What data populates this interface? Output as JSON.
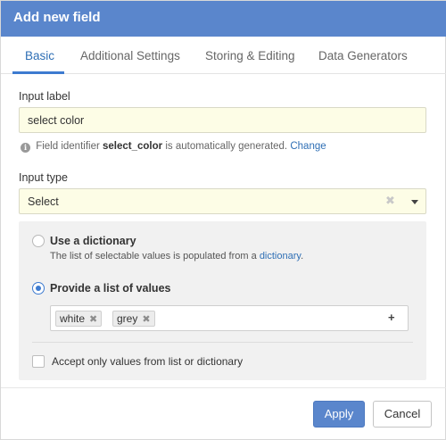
{
  "dialog": {
    "title": "Add new field"
  },
  "tabs": [
    {
      "label": "Basic",
      "active": true
    },
    {
      "label": "Additional Settings",
      "active": false
    },
    {
      "label": "Storing & Editing",
      "active": false
    },
    {
      "label": "Data Generators",
      "active": false
    }
  ],
  "input_label": {
    "label": "Input label",
    "value": "select color"
  },
  "hint": {
    "prefix": "Field identifier",
    "identifier": "select_color",
    "suffix": "is automatically generated.",
    "link": "Change",
    "icon": "info-icon"
  },
  "input_type": {
    "label": "Input type",
    "value": "Select",
    "clear_icon": "✖",
    "arrow_icon": "caret-down-icon"
  },
  "options": {
    "dictionary": {
      "title": "Use a dictionary",
      "desc_prefix": "The list of selectable values is populated from a",
      "desc_link": "dictionary",
      "desc_suffix": ".",
      "checked": false
    },
    "list": {
      "title": "Provide a list of values",
      "checked": true,
      "values": [
        {
          "label": "white",
          "remove": "✖"
        },
        {
          "label": "grey",
          "remove": "✖"
        }
      ],
      "add_icon": "+"
    },
    "restrict": {
      "label": "Accept only values from list or dictionary",
      "checked": false
    }
  },
  "footer": {
    "apply": "Apply",
    "cancel": "Cancel"
  },
  "colors": {
    "header": "#5a86cc",
    "accent": "#3d7bd0",
    "link": "#2f6fb5",
    "input_bg": "#fdfde6",
    "panel_bg": "#f1f1f1"
  }
}
